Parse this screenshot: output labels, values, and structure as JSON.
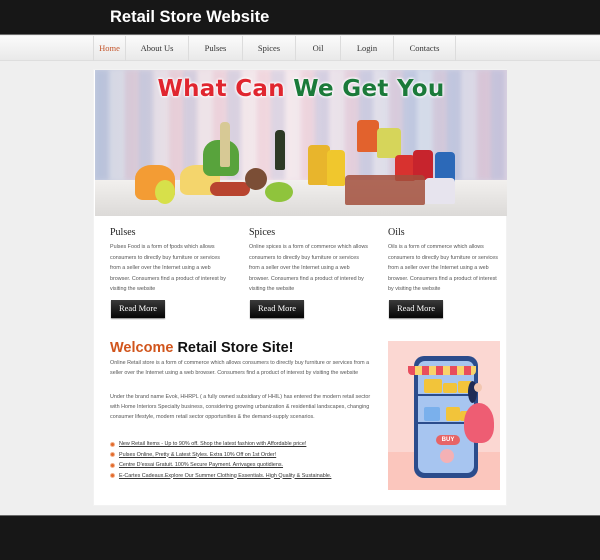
{
  "header": {
    "title": "Retail Store Website"
  },
  "nav": {
    "items": [
      {
        "label": "Home",
        "active": true
      },
      {
        "label": "About Us",
        "active": false
      },
      {
        "label": "Pulses",
        "active": false
      },
      {
        "label": "Spices",
        "active": false
      },
      {
        "label": "Oil",
        "active": false
      },
      {
        "label": "Login",
        "active": false
      },
      {
        "label": "Contacts",
        "active": false
      }
    ]
  },
  "banner": {
    "title_red_1": "What Can",
    "title_green": "We Get You",
    "alt": "Grocery products banner"
  },
  "columns": [
    {
      "title": "Pulses",
      "text": "Pulses Food is a form of fpods which allows consumers to directly buy furniture or services from a seller over the Internet using a web browser. Consumers find a product of interest by visiting the website",
      "button": "Read More"
    },
    {
      "title": "Spices",
      "text": "Online spices is a form of commerce which allows consumers to directly buy furniture or services from a seller over the Internet using a web browser. Consumers find a product of intered by visiting the website",
      "button": "Read More"
    },
    {
      "title": "Oils",
      "text": "Oils is a form of commerce which allows consumers to directly buy furniture or services from a seller over the Internet using a web browser. Consumers find a product of interest by visiting the website",
      "button": "Read More"
    }
  ],
  "welcome": {
    "title_accent": "Welcome",
    "title_rest": "Retail Store Site!",
    "paragraph_1": "Online Retail store is a form of commerce which allows consumers to directly buy furniture or services from a seller over the Internet using a web browser. Consumers find a product of interest by visiting the website",
    "paragraph_2": "Under the brand name Evok, HHRPL ( a fully owned subsidiary of HHIL) has entered the modern retail sector with Home Interiors Specialty business, considering growing urbanization & residential landscapes, changing consumer lifestyle, modern retail sector opportunities & the demand-supply scenarios.",
    "links": [
      "New Retail Items - Up to 90% off. Shop the latest fashion with Affordable price!",
      "Pulses Online, Pretty & Latest Styles. Extra 10% Off on 1st Order!",
      "Centre D'essai Gratuit. 100% Secure Payment. Arrivages quotidiens.",
      "E-Cartes Cadeaux.Explore Our Summer Clothing Essentials. High Quality & Sustainable."
    ]
  },
  "promo": {
    "buy_label": "BUY"
  },
  "colors": {
    "header_bg": "#171717",
    "nav_active": "#c4552b",
    "welcome_accent": "#d1551c",
    "bullet": "#e26a2c",
    "banner_red": "#e0262f",
    "banner_green": "#1b7a3a"
  }
}
